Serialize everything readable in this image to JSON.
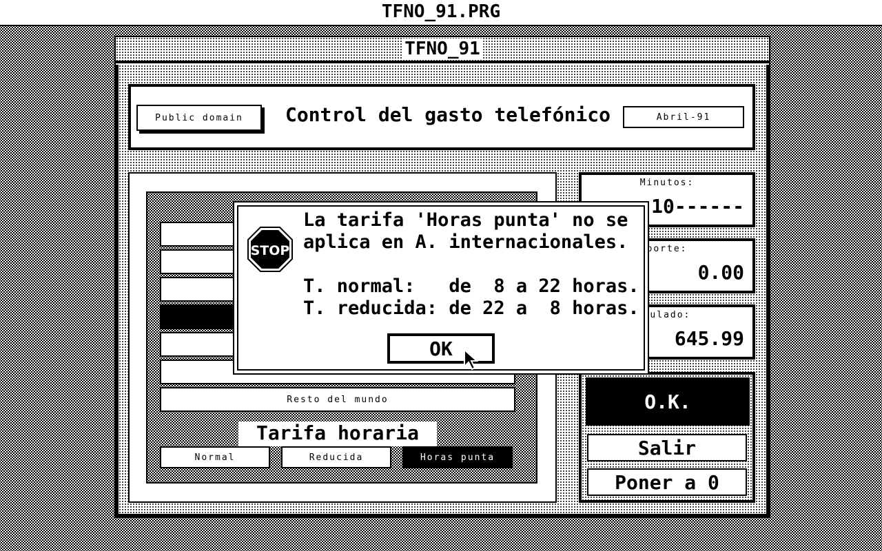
{
  "menubar": {
    "title": "TFNO_91.PRG"
  },
  "window": {
    "title": "TFNO_91"
  },
  "header": {
    "public_domain": "Public domain",
    "title": "Control del gasto telefónico",
    "date": "Abril-91"
  },
  "destinations": {
    "items": [
      {
        "label": ""
      },
      {
        "label": ""
      },
      {
        "label": ""
      },
      {
        "label": ""
      },
      {
        "label": ""
      },
      {
        "label": ""
      },
      {
        "label": "Resto del mundo"
      }
    ],
    "selected_index": 3
  },
  "tarifa": {
    "title": "Tarifa horaria",
    "options": [
      "Normal",
      "Reducida",
      "Horas punta"
    ],
    "selected": "Horas punta"
  },
  "stats": {
    "minutos": {
      "label": "Minutos:",
      "value": "10------"
    },
    "importe": {
      "label": "porte:",
      "value": "0.00"
    },
    "acumulado": {
      "label": "mulado:",
      "value": "645.99"
    }
  },
  "actions": {
    "ok": "O.K.",
    "salir": "Salir",
    "reset": "Poner a 0"
  },
  "alert": {
    "icon": "stop-sign-icon",
    "icon_text": "STOP",
    "lines": [
      "La tarifa 'Horas punta' no se",
      "aplica en A. internacionales.",
      "",
      "T. normal:   de  8 a 22 horas.",
      "T. reducida: de 22 a  8 horas."
    ],
    "ok_button": "OK"
  }
}
